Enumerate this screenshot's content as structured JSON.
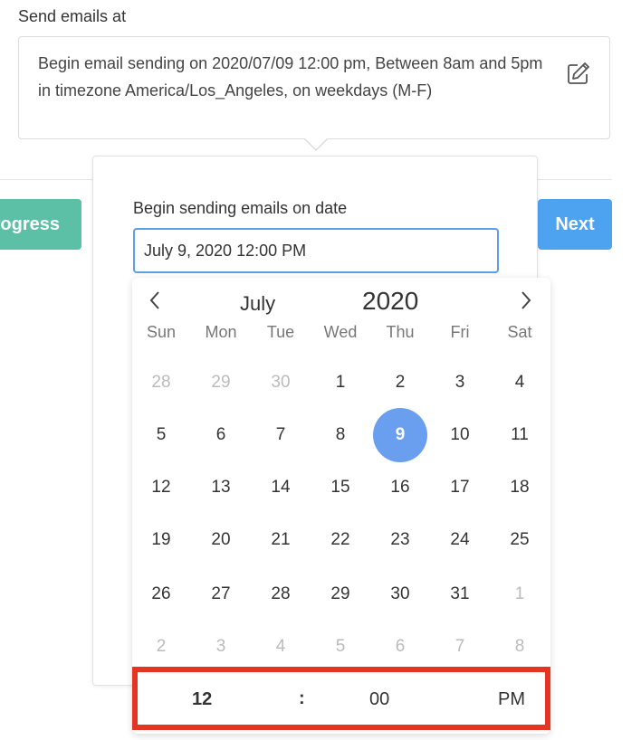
{
  "section_label": "Send emails at",
  "summary": {
    "text": "Begin email sending on 2020/07/09 12:00 pm, Between 8am and 5pm in timezone America/Los_Angeles, on weekdays (M-F)"
  },
  "buttons": {
    "progress_label": "rogress",
    "next_label": "Next"
  },
  "popover": {
    "label": "Begin sending emails on date",
    "input_value": "July 9, 2020 12:00 PM"
  },
  "calendar": {
    "month": "July",
    "year": "2020",
    "prev_icon": "chevron-left-icon",
    "next_icon": "chevron-right-icon",
    "weekdays": [
      "Sun",
      "Mon",
      "Tue",
      "Wed",
      "Thu",
      "Fri",
      "Sat"
    ],
    "weeks": [
      [
        {
          "d": "28",
          "muted": true
        },
        {
          "d": "29",
          "muted": true
        },
        {
          "d": "30",
          "muted": true
        },
        {
          "d": "1"
        },
        {
          "d": "2"
        },
        {
          "d": "3"
        },
        {
          "d": "4"
        }
      ],
      [
        {
          "d": "5"
        },
        {
          "d": "6"
        },
        {
          "d": "7"
        },
        {
          "d": "8"
        },
        {
          "d": "9",
          "selected": true
        },
        {
          "d": "10"
        },
        {
          "d": "11"
        }
      ],
      [
        {
          "d": "12"
        },
        {
          "d": "13"
        },
        {
          "d": "14"
        },
        {
          "d": "15"
        },
        {
          "d": "16"
        },
        {
          "d": "17"
        },
        {
          "d": "18"
        }
      ],
      [
        {
          "d": "19"
        },
        {
          "d": "20"
        },
        {
          "d": "21"
        },
        {
          "d": "22"
        },
        {
          "d": "23"
        },
        {
          "d": "24"
        },
        {
          "d": "25"
        }
      ],
      [
        {
          "d": "26"
        },
        {
          "d": "27"
        },
        {
          "d": "28"
        },
        {
          "d": "29"
        },
        {
          "d": "30"
        },
        {
          "d": "31"
        },
        {
          "d": "1",
          "muted": true
        }
      ],
      [
        {
          "d": "2",
          "muted": true
        },
        {
          "d": "3",
          "muted": true
        },
        {
          "d": "4",
          "muted": true
        },
        {
          "d": "5",
          "muted": true
        },
        {
          "d": "6",
          "muted": true
        },
        {
          "d": "7",
          "muted": true
        },
        {
          "d": "8",
          "muted": true
        }
      ]
    ]
  },
  "time": {
    "hour": "12",
    "separator": ":",
    "minute": "00",
    "ampm": "PM"
  },
  "colors": {
    "selected_day": "#6a9ff0",
    "highlight_border": "#e53421",
    "progress_button": "#5bc0a6",
    "next_button": "#4ea3f1",
    "input_focus": "#5b9ee8"
  }
}
